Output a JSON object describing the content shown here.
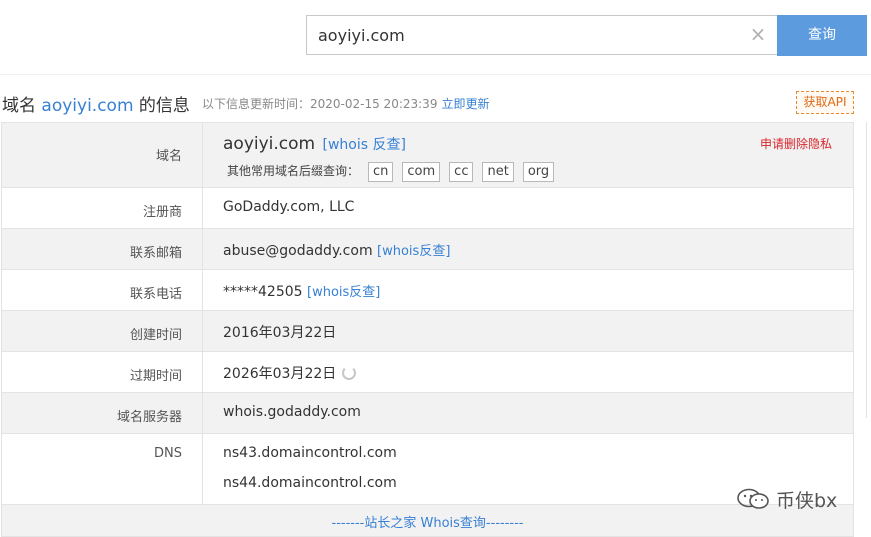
{
  "search": {
    "value": "aoyiyi.com",
    "clear_icon": "close-icon",
    "button_label": "查询"
  },
  "header": {
    "prefix": "域名",
    "domain": "aoyiyi.com",
    "suffix": "的信息",
    "update_label": "以下信息更新时间：2020-02-15 20:23:39",
    "refresh_label": "立即更新",
    "api_label": "获取API"
  },
  "rows": {
    "domain": {
      "label": "域名",
      "value": "aoyiyi.com",
      "whois_link": "[whois 反查]",
      "suffix_label": "其他常用域名后缀查询：",
      "suffixes": [
        "cn",
        "com",
        "cc",
        "net",
        "org"
      ],
      "privacy_link": "申请删除隐私"
    },
    "registrar": {
      "label": "注册商",
      "value": "GoDaddy.com, LLC"
    },
    "email": {
      "label": "联系邮箱",
      "value": "abuse@godaddy.com",
      "link": "[whois反查]"
    },
    "phone": {
      "label": "联系电话",
      "value": "*****42505",
      "link": "[whois反查]"
    },
    "created": {
      "label": "创建时间",
      "value": "2016年03月22日"
    },
    "expires": {
      "label": "过期时间",
      "value": "2026年03月22日",
      "icon": "refresh-icon"
    },
    "nameserver": {
      "label": "域名服务器",
      "value": "whois.godaddy.com"
    },
    "dns": {
      "label": "DNS",
      "values": [
        "ns43.domaincontrol.com",
        "ns44.domaincontrol.com"
      ]
    }
  },
  "footer": {
    "label": "-------站长之家 Whois查询--------"
  },
  "watermark": {
    "text": "币侠bx",
    "icon": "wechat-icon"
  }
}
